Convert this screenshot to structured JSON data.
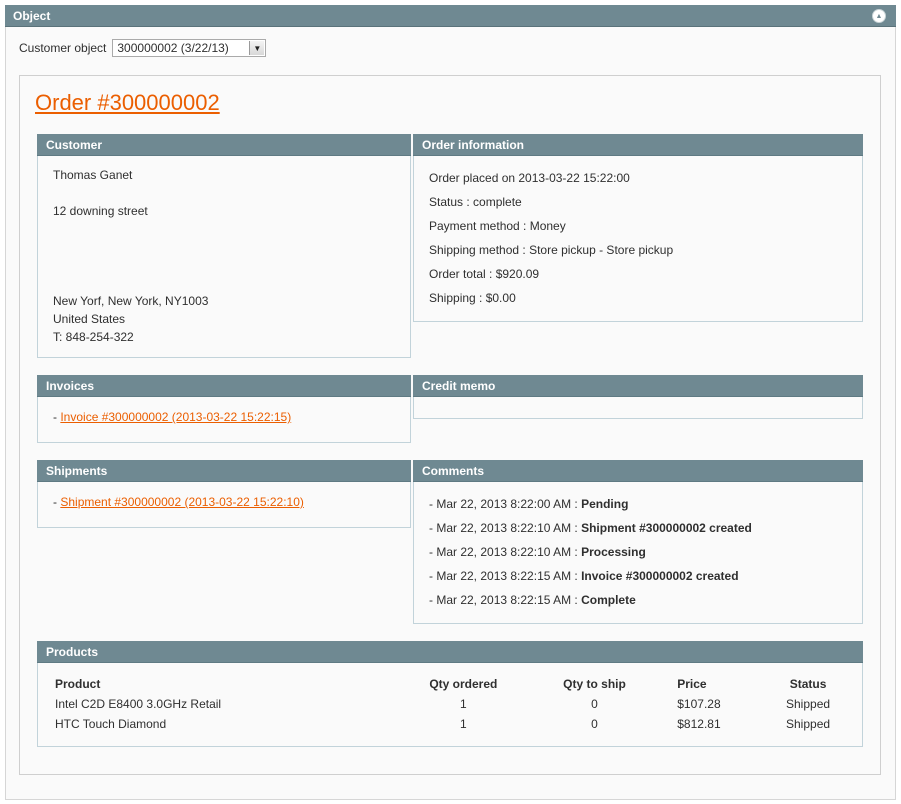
{
  "header": {
    "title": "Object"
  },
  "selector": {
    "label": "Customer object",
    "value": "300000002 (3/22/13)"
  },
  "order": {
    "title": "Order #300000002"
  },
  "customer": {
    "title": "Customer",
    "name": "Thomas Ganet",
    "street": "12 downing street",
    "city_line": "New Yorf, New York, NY1003",
    "country": "United States",
    "phone": "T: 848-254-322"
  },
  "order_info": {
    "title": "Order information",
    "lines": [
      "Order placed on 2013-03-22 15:22:00",
      "Status : complete",
      "Payment method : Money",
      "Shipping method : Store pickup - Store pickup",
      "Order total : $920.09",
      "Shipping : $0.00"
    ]
  },
  "invoices": {
    "title": "Invoices",
    "items": [
      {
        "prefix": "- ",
        "link": "Invoice #300000002 (2013-03-22 15:22:15)"
      }
    ]
  },
  "credit_memo": {
    "title": "Credit memo"
  },
  "shipments": {
    "title": "Shipments",
    "items": [
      {
        "prefix": "- ",
        "link": "Shipment #300000002 (2013-03-22 15:22:10)"
      }
    ]
  },
  "comments": {
    "title": "Comments",
    "items": [
      {
        "date": "- Mar 22, 2013 8:22:00 AM : ",
        "text": "Pending"
      },
      {
        "date": "- Mar 22, 2013 8:22:10 AM : ",
        "text": "Shipment #300000002 created"
      },
      {
        "date": "- Mar 22, 2013 8:22:10 AM : ",
        "text": "Processing"
      },
      {
        "date": "- Mar 22, 2013 8:22:15 AM : ",
        "text": "Invoice #300000002 created"
      },
      {
        "date": "- Mar 22, 2013 8:22:15 AM : ",
        "text": "Complete"
      }
    ]
  },
  "products": {
    "title": "Products",
    "columns": {
      "product": "Product",
      "qty_ordered": "Qty ordered",
      "qty_to_ship": "Qty to ship",
      "price": "Price",
      "status": "Status"
    },
    "rows": [
      {
        "product": "Intel C2D E8400 3.0GHz Retail",
        "qty_ordered": "1",
        "qty_to_ship": "0",
        "price": "$107.28",
        "status": "Shipped"
      },
      {
        "product": "HTC Touch Diamond",
        "qty_ordered": "1",
        "qty_to_ship": "0",
        "price": "$812.81",
        "status": "Shipped"
      }
    ]
  },
  "colors": {
    "header_bg": "#6f8992",
    "link": "#eb5e00",
    "panel_border": "#c2d3da"
  }
}
